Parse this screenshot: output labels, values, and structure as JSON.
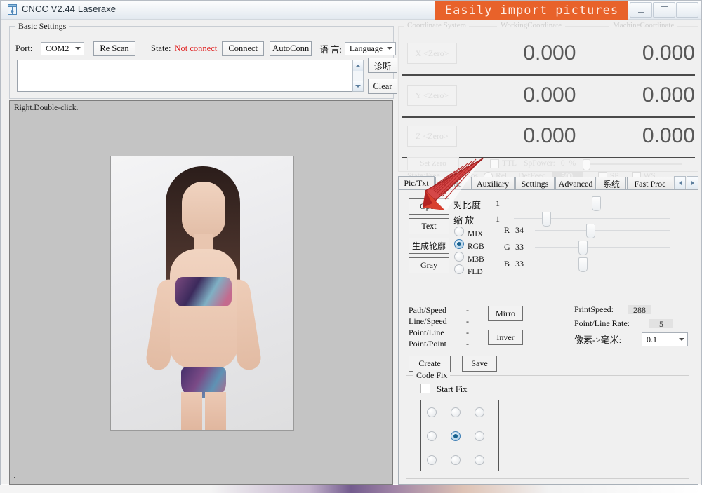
{
  "window": {
    "title": "CNCC V2.44  Laseraxe",
    "icon": "app-icon",
    "controls": [
      "minimize",
      "maximize",
      "close"
    ]
  },
  "banner": {
    "text": "Easily import pictures",
    "color": "#e8622a"
  },
  "basic_settings": {
    "legend": "Basic Settings",
    "port_label": "Port:",
    "port_value": "COM2",
    "rescan_button": "Re Scan",
    "state_label": "State:",
    "state_value": "Not connect",
    "state_color": "#e02020",
    "connect_button": "Connect",
    "autoconn_button": "AutoConn",
    "language_label": "语  言:",
    "language_value": "Language",
    "log_value": "",
    "diagnose_button": "诊断",
    "clear_button": "Clear"
  },
  "canvas": {
    "hint": "Right.Double-click.",
    "image_alt": "imported picture"
  },
  "coordinate_system": {
    "legend": "Coordinate System",
    "working_header": "WorkingCoordinate",
    "machine_header": "MachineCoordinate",
    "axes": [
      {
        "zero_button": "X <Zero>",
        "working": "0.000",
        "machine": "0.000"
      },
      {
        "zero_button": "Y <Zero>",
        "working": "0.000",
        "machine": "0.000"
      },
      {
        "zero_button": "Z <Zero>",
        "working": "0.000",
        "machine": "0.000"
      }
    ],
    "set_zero_button": "Set Zero",
    "ttl_label": "TTL",
    "sppower_label": "SpPower:",
    "sppower_value": "0",
    "sppower_unit": "%",
    "state_label": "State:Free",
    "abs_label": "Abs",
    "rel_label": "Rel",
    "deffeed_label": "DefFeed",
    "deffeed_value": "500",
    "sp_label": "SP",
    "ws_label": "WS"
  },
  "tabs": {
    "items": [
      {
        "label": "Pic/Txt",
        "active": true
      },
      {
        "label": "Code",
        "active": false
      },
      {
        "label": "Auxiliary",
        "active": false
      },
      {
        "label": "Settings",
        "active": false
      },
      {
        "label": "Advanced",
        "active": false
      },
      {
        "label": "系统",
        "active": false
      },
      {
        "label": "Fast Proc",
        "active": false
      }
    ]
  },
  "pic_txt": {
    "buttons": {
      "open": "Open",
      "text": "Text",
      "outline": "生成轮廓",
      "gray": "Gray"
    },
    "modes": [
      {
        "label": "MIX",
        "selected": false
      },
      {
        "label": "RGB",
        "selected": true
      },
      {
        "label": "M3B",
        "selected": false
      },
      {
        "label": "FLD",
        "selected": false
      }
    ],
    "sliders": [
      {
        "label": "对比度",
        "value": "1",
        "pos": 50
      },
      {
        "label": "缩  放",
        "value": "1",
        "pos": 18
      }
    ],
    "rgb_sliders": [
      {
        "label": "R",
        "value": "34",
        "pos": 38
      },
      {
        "label": "G",
        "value": "33",
        "pos": 32
      },
      {
        "label": "B",
        "value": "33",
        "pos": 32
      }
    ],
    "stats": [
      {
        "label": "Path/Speed",
        "value": "-"
      },
      {
        "label": "Line/Speed",
        "value": "-"
      },
      {
        "label": "Point/Line",
        "value": "-"
      },
      {
        "label": "Point/Point",
        "value": "-"
      }
    ],
    "mirro_button": "Mirro",
    "inver_button": "Inver",
    "create_button": "Create",
    "save_button": "Save",
    "print_speed_label": "PrintSpeed:",
    "print_speed_value": "288",
    "point_line_rate_label": "Point/Line Rate:",
    "point_line_rate_value": "5",
    "pixel_mm_label": "像素->毫米:",
    "pixel_mm_value": "0.1"
  },
  "code_fix": {
    "legend": "Code Fix",
    "start_fix_label": "Start Fix",
    "start_fix_checked": false,
    "grid_selected_index": 4
  }
}
